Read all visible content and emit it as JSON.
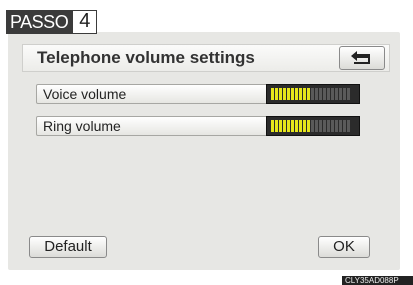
{
  "step": {
    "word": "PASSO",
    "number": "4"
  },
  "header": {
    "title": "Telephone volume settings"
  },
  "icons": {
    "back": "return-arrow-icon"
  },
  "settings": [
    {
      "label": "Voice volume",
      "level": 0.5
    },
    {
      "label": "Ring volume",
      "level": 0.5
    }
  ],
  "buttons": {
    "default_label": "Default",
    "ok_label": "OK"
  },
  "image_code": "CLY35AD088P",
  "colors": {
    "meter_on": "#e6e61b",
    "meter_off": "#5a5a5a",
    "screen_bg": "#e7e7e4"
  }
}
